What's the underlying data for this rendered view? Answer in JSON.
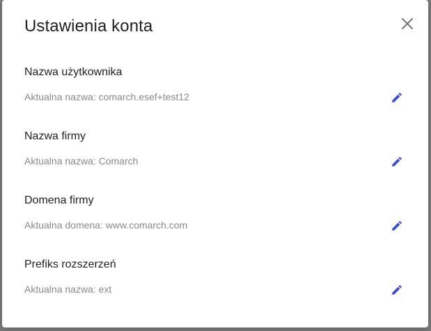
{
  "dialog": {
    "title": "Ustawienia konta",
    "close_icon": "close-icon",
    "accent_color": "#3d4fd6"
  },
  "sections": [
    {
      "label": "Nazwa użytkownika",
      "value": "Aktualna nazwa: comarch.esef+test12",
      "icon": "pencil-icon"
    },
    {
      "label": "Nazwa firmy",
      "value": "Aktualna nazwa: Comarch",
      "icon": "pencil-icon"
    },
    {
      "label": "Domena firmy",
      "value": "Aktualna domena: www.comarch.com",
      "icon": "pencil-icon"
    },
    {
      "label": "Prefiks rozszerzeń",
      "value": "Aktualna nazwa: ext",
      "icon": "pencil-icon"
    }
  ]
}
